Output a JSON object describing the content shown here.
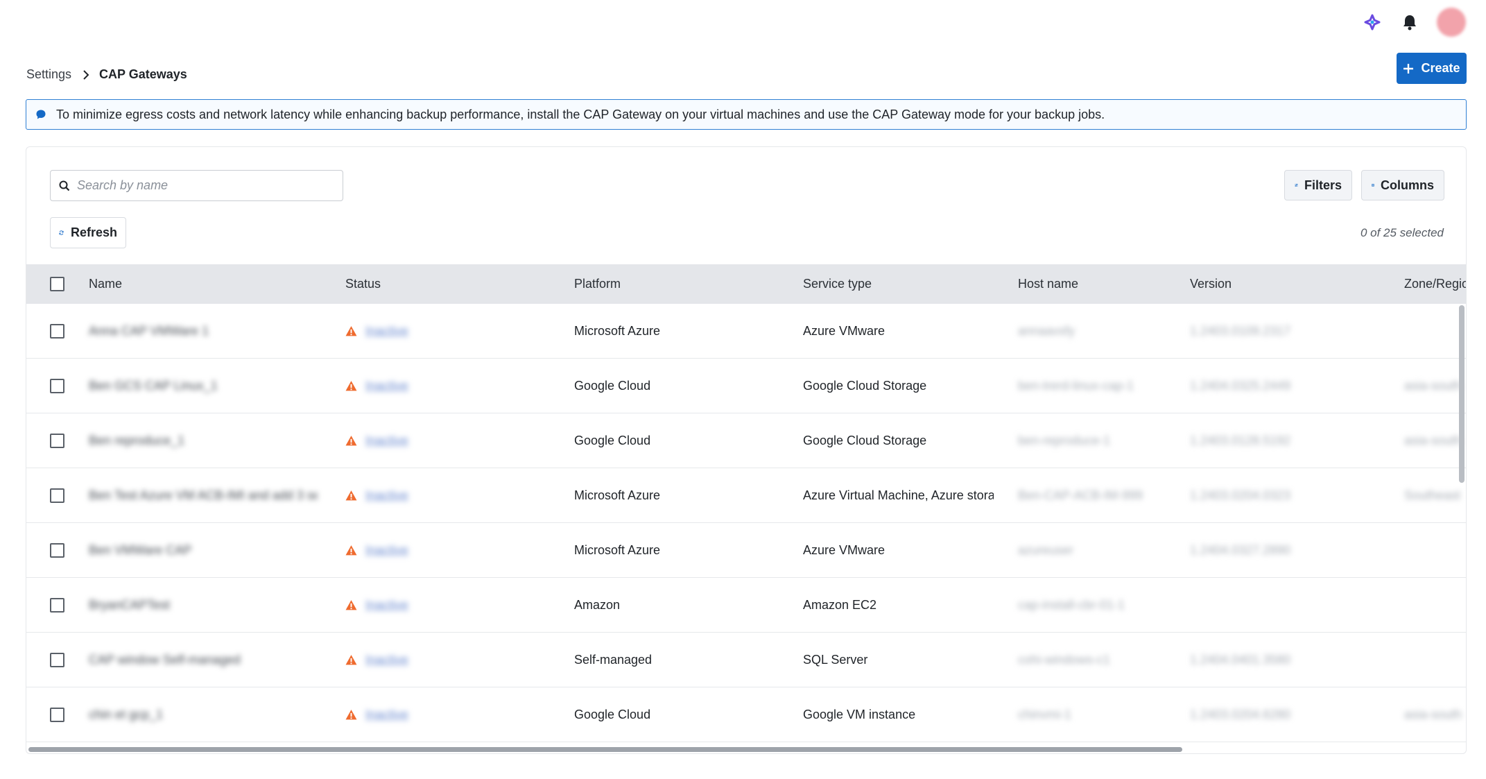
{
  "header": {
    "icons": [
      "copilot-icon",
      "bell-icon",
      "avatar"
    ]
  },
  "breadcrumb": {
    "root": "Settings",
    "current": "CAP Gateways"
  },
  "create_label": "Create",
  "banner": {
    "text": "To minimize egress costs and network latency while enhancing backup performance, install the CAP Gateway on your virtual machines and use the CAP Gateway mode for your backup jobs."
  },
  "toolbar": {
    "search_placeholder": "Search by name",
    "filters_label": "Filters",
    "columns_label": "Columns",
    "refresh_label": "Refresh",
    "selection_count": "0 of 25 selected"
  },
  "table": {
    "columns": [
      "Name",
      "Status",
      "Platform",
      "Service type",
      "Host name",
      "Version",
      "Zone/Region"
    ],
    "rows": [
      {
        "name": "Anna CAP VMWare 1",
        "status": "Inactive",
        "platform": "Microsoft Azure",
        "service_type": "Azure VMware",
        "host": "annaavsfy",
        "version": "1.2403.0109.2317",
        "zone": ""
      },
      {
        "name": "Ben GCS CAP Linux_1",
        "status": "Inactive",
        "platform": "Google Cloud",
        "service_type": "Google Cloud Storage",
        "host": "ben-trerd-linux-cap-1",
        "version": "1.2404.0325.2449",
        "zone": "asia-south"
      },
      {
        "name": "Ben reproduce_1",
        "status": "Inactive",
        "platform": "Google Cloud",
        "service_type": "Google Cloud Storage",
        "host": "ben-reproduce-1",
        "version": "1.2403.0128.5192",
        "zone": "asia-south"
      },
      {
        "name": "Ben Test Azure VM ACB-IMI and add 3 se...",
        "status": "Inactive",
        "platform": "Microsoft Azure",
        "service_type": "Azure Virtual Machine, Azure storage",
        "host": "Ben-CAP-ACB-IM-999",
        "version": "1.2403.0204.0323",
        "zone": "Southeast"
      },
      {
        "name": "Ben VMWare CAP",
        "status": "Inactive",
        "platform": "Microsoft Azure",
        "service_type": "Azure VMware",
        "host": "azureuser",
        "version": "1.2404.0327.2890",
        "zone": ""
      },
      {
        "name": "BryanCAPTest",
        "status": "Inactive",
        "platform": "Amazon",
        "service_type": "Amazon EC2",
        "host": "cap-install-cbr-01-1",
        "version": "",
        "zone": ""
      },
      {
        "name": "CAP window Self-managed",
        "status": "Inactive",
        "platform": "Self-managed",
        "service_type": "SQL Server",
        "host": "cohi-windows-c1",
        "version": "1.2404.0401.3580",
        "zone": ""
      },
      {
        "name": "chin et gcp_1",
        "status": "Inactive",
        "platform": "Google Cloud",
        "service_type": "Google VM instance",
        "host": "chinvmi-1",
        "version": "1.2403.0204.6280",
        "zone": "asia-south"
      }
    ]
  },
  "colors": {
    "primary": "#1469c6",
    "banner_border": "#2f7fd4",
    "status_warning": "#ef6b2f",
    "header_bg": "#e4e6ea"
  }
}
